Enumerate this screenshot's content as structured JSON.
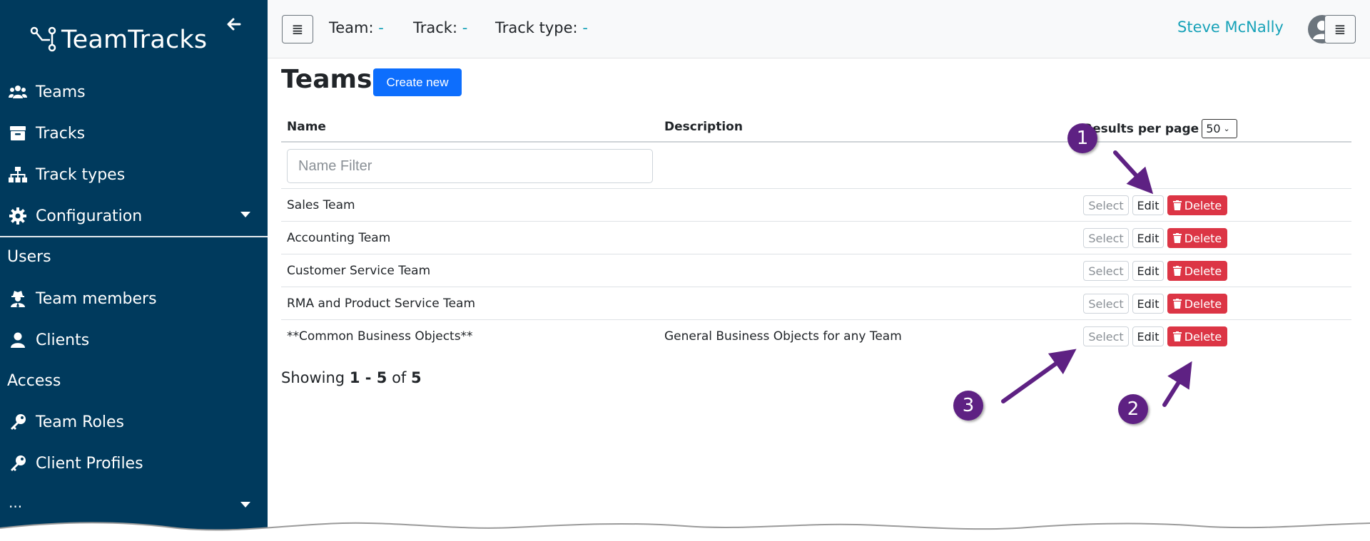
{
  "app": {
    "brand": "TeamTracks"
  },
  "sidebar": {
    "items": [
      {
        "label": "Teams",
        "icon": "users-icon"
      },
      {
        "label": "Tracks",
        "icon": "archive-box-icon"
      },
      {
        "label": "Track types",
        "icon": "sitemap-icon"
      },
      {
        "label": "Configuration",
        "icon": "gear-icon"
      },
      {
        "label": "Team members",
        "icon": "user-secret-icon"
      },
      {
        "label": "Clients",
        "icon": "user-icon"
      },
      {
        "label": "Team Roles",
        "icon": "key-icon"
      },
      {
        "label": "Client Profiles",
        "icon": "key-icon"
      },
      {
        "label": "...",
        "icon": ""
      }
    ],
    "sections": {
      "users": "Users",
      "access": "Access"
    }
  },
  "topbar": {
    "team_label": "Team:",
    "team_value": "-",
    "track_label": "Track:",
    "track_value": "-",
    "track_type_label": "Track type:",
    "track_type_value": "-",
    "user_name": "Steve McNally"
  },
  "main": {
    "title": "Teams",
    "create_label": "Create new",
    "columns": {
      "name": "Name",
      "description": "Description"
    },
    "results_per_page_label": "Results per page",
    "results_per_page_value": "50",
    "name_filter_placeholder": "Name Filter",
    "rows": [
      {
        "name": "Sales Team",
        "description": ""
      },
      {
        "name": "Accounting Team",
        "description": ""
      },
      {
        "name": "Customer Service Team",
        "description": ""
      },
      {
        "name": "RMA and Product Service Team",
        "description": ""
      },
      {
        "name": "**Common Business Objects**",
        "description": "General Business Objects for any Team"
      }
    ],
    "row_actions": {
      "select": "Select",
      "edit": "Edit",
      "delete": "Delete"
    },
    "showing_prefix": "Showing",
    "showing_range": "1 - 5",
    "showing_of": "of",
    "showing_total": "5"
  },
  "annotations": [
    "1",
    "2",
    "3"
  ],
  "colors": {
    "sidebar_bg": "#003a5d",
    "accent_teal": "#17a2b8",
    "primary_blue": "#0d6efd",
    "danger_red": "#dc3545",
    "annotation_purple": "#5e2183"
  }
}
